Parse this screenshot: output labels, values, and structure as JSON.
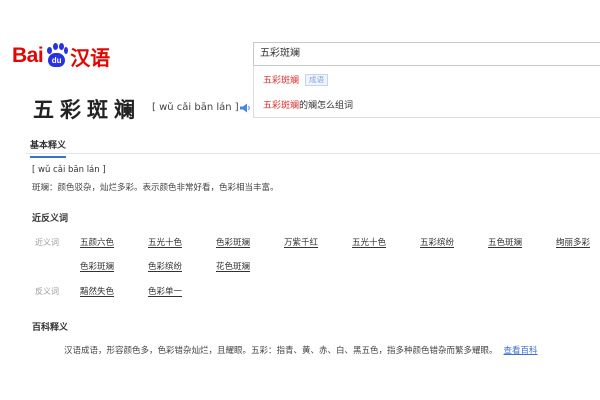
{
  "logo": {
    "brand": "Bai",
    "paw": "du",
    "product": "汉语"
  },
  "search": {
    "value": "五彩斑斓"
  },
  "suggestions": [
    {
      "highlight": "五彩斑斓",
      "rest": "",
      "tag": "成语"
    },
    {
      "highlight": "五彩斑斓",
      "rest": "的斓怎么组词",
      "tag": ""
    }
  ],
  "word": {
    "title": "五彩斑斓",
    "pinyin": "[ wǔ cǎi bān lán ]",
    "sound_icon": "speaker-icon"
  },
  "tabs": {
    "basic": "基本释义"
  },
  "basic": {
    "pinyin": "[ wǔ cǎi bān lán ]",
    "definition": "斑斓：颜色驳杂，灿烂多彩。表示颜色非常好看，色彩相当丰富。"
  },
  "synonyms_section": {
    "title": "近反义词",
    "synonym_label": "近义词",
    "antonym_label": "反义词",
    "synonyms": [
      "五颜六色",
      "五光十色",
      "色彩斑斓",
      "万紫千红",
      "五光十色",
      "五彩缤纷",
      "五色斑斓",
      "绚丽多彩",
      "色彩斑斓",
      "色彩缤纷",
      "花色斑斓"
    ],
    "antonyms": [
      "黯然失色",
      "色彩单一"
    ]
  },
  "baike": {
    "title": "百科释义",
    "text": "汉语成语，形容颜色多，色彩错杂灿烂，且耀眼。五彩：指青、黄、赤、白、黑五色，指多种颜色错杂而繁多耀眼。",
    "more": "查看百科"
  },
  "colors": {
    "brand_red": "#e10602",
    "brand_blue": "#2932e1",
    "link_blue": "#3d6fcf",
    "highlight_red": "#e02c2c"
  }
}
